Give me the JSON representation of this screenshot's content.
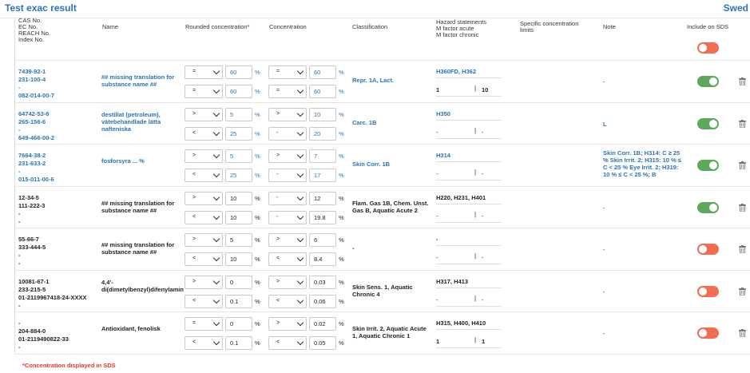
{
  "header": {
    "title": "Test exac result",
    "country": "Swed"
  },
  "columns": {
    "ids": [
      "CAS No.",
      "EC No.",
      "REACH No.",
      "Index No."
    ],
    "name": "Name",
    "rounded": "Rounded concentration*",
    "concentration": "Concentration",
    "classification": "Classification",
    "hazard": [
      "Hazard statements",
      "M factor acute",
      "M factor chronic"
    ],
    "specific": [
      "Specific concentration",
      "limits"
    ],
    "note": "Note",
    "include": "Include on SDS"
  },
  "rows": [
    {
      "ids": [
        "7439-92-1",
        "231-100-4",
        "-",
        "082-014-00-7"
      ],
      "name": "## missing translation for substance name ##",
      "r1op": "=",
      "r1": "60",
      "r2op": "=",
      "r2": "60",
      "c1op": "=",
      "c1": "60",
      "c2op": "=",
      "c2": "60",
      "classification": "Repr. 1A, Lact.",
      "hazard": "H360FD, H362",
      "ma": "1",
      "mc": "10",
      "specific": "",
      "note": "-",
      "include": "on"
    },
    {
      "ids": [
        "64742-53-6",
        "265-156-6",
        "-",
        "649-466-00-2"
      ],
      "name": "destillat (petroleum), vätebehandlade lätta nafteniska",
      "r1op": ">",
      "r1": "5",
      "r2op": "<",
      "r2": "25",
      "c1op": ">",
      "c1": "10",
      "c2op": "-",
      "c2": "20",
      "classification": "Carc. 1B",
      "hazard": "H350",
      "ma": "-",
      "mc": "-",
      "specific": "",
      "note": "L",
      "include": "on"
    },
    {
      "ids": [
        "7664-38-2",
        "231-633-2",
        "-",
        "015-011-00-6"
      ],
      "name": "fosforsyra ... %",
      "r1op": ">",
      "r1": "5",
      "r2op": "<",
      "r2": "25",
      "c1op": ">",
      "c1": "7",
      "c2op": "-",
      "c2": "17",
      "classification": "Skin Corr. 1B",
      "hazard": "H314",
      "ma": "-",
      "mc": "-",
      "specific": "",
      "note": "Skin Corr. 1B; H314: C ≥ 25 % Skin Irrit. 2; H315: 10 % ≤ C < 25 % Eye Irrit. 2; H319: 10 % ≤ C < 25 %; B",
      "include": "on"
    },
    {
      "ids": [
        "12-34-5",
        "111-222-3",
        "-",
        "-"
      ],
      "name": "## missing translation for substance name ##",
      "r1op": ">",
      "r1": "10",
      "r2op": "<",
      "r2": "10",
      "c1op": "-",
      "c1": "12",
      "c2op": "-",
      "c2": "19.8",
      "classification": "Flam. Gas 1B, Chem. Unst. Gas B, Aquatic Acute 2",
      "hazard": "H220, H231, H401",
      "ma": "-",
      "mc": "-",
      "specific": "",
      "note": "-",
      "include": "on"
    },
    {
      "ids": [
        "55-66-7",
        "333-444-5",
        "-",
        "-"
      ],
      "name": "## missing translation for substance name ##",
      "r1op": ">",
      "r1": "5",
      "r2op": "<",
      "r2": "10",
      "c1op": ">",
      "c1": "6",
      "c2op": "<",
      "c2": "8.4",
      "classification": "-",
      "hazard": "-",
      "ma": "-",
      "mc": "-",
      "specific": "",
      "note": "-",
      "include": "off"
    },
    {
      "ids": [
        "10081-67-1",
        "233-215-5",
        "01-2119967418-24-XXXX",
        "-"
      ],
      "name": "4,4'-di(dimetylbenzyl)difenylamin",
      "r1op": ">",
      "r1": "0",
      "r2op": "<",
      "r2": "0.1",
      "c1op": ">",
      "c1": "0.03",
      "c2op": "<",
      "c2": "0.06",
      "classification": "Skin Sens. 1, Aquatic Chronic 4",
      "hazard": "H317, H413",
      "ma": "-",
      "mc": "-",
      "specific": "",
      "note": "-",
      "include": "off"
    },
    {
      "ids": [
        "-",
        "204-884-0",
        "01-2119490822-33",
        "-"
      ],
      "name": "Antioxidant, fenolisk",
      "r1op": "=",
      "r1": "0",
      "r2op": "<",
      "r2": "0.1",
      "c1op": ">",
      "c1": "0.02",
      "c2op": "<",
      "c2": "0.05",
      "classification": "Skin Irrit. 2, Aquatic Acute 1, Aquatic Chronic 1",
      "hazard": "H315, H400, H410",
      "ma": "1",
      "mc": "1",
      "specific": "",
      "note": "-",
      "include": "off"
    }
  ],
  "footer": "*Concentration displayed in SDS",
  "colors": {
    "blue": "#2a73b7",
    "on": "#5ca95c",
    "off": "#f26d4f",
    "required": "#e63a2a"
  }
}
